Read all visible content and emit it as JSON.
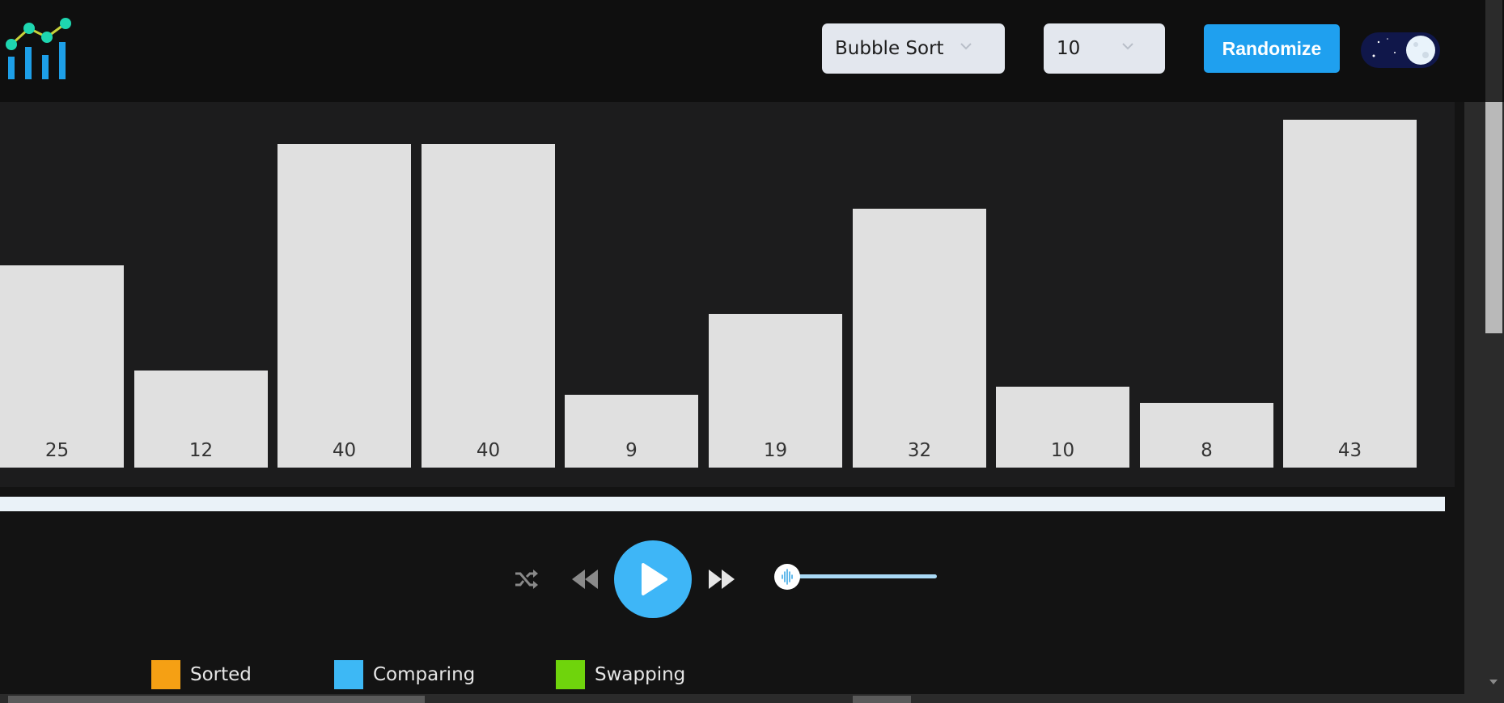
{
  "header": {
    "algorithm_select": {
      "value": "Bubble Sort"
    },
    "count_select": {
      "value": "10"
    },
    "randomize_label": "Randomize",
    "theme_toggle": {
      "mode": "dark",
      "icon": "moon-icon"
    }
  },
  "colors": {
    "accent": "#1fa0ef",
    "play": "#3eb6f7",
    "bar_default": "#e0e0e0",
    "sorted": "#f5a014",
    "comparing": "#3db8f5",
    "swapping": "#6fd40c"
  },
  "chart_data": {
    "type": "bar",
    "categories": [
      "25",
      "12",
      "40",
      "40",
      "9",
      "19",
      "32",
      "10",
      "8",
      "43"
    ],
    "values": [
      25,
      12,
      40,
      40,
      9,
      19,
      32,
      10,
      8,
      43
    ],
    "ylim": [
      0,
      43
    ]
  },
  "progress": 0,
  "speed": 0,
  "controls": {
    "shuffle_icon": "shuffle-icon",
    "rewind_icon": "rewind-icon",
    "play_icon": "play-icon",
    "forward_icon": "fast-forward-icon",
    "speed_icon": "sound-wave-icon"
  },
  "legend": [
    {
      "label": "Sorted",
      "color": "#f5a014"
    },
    {
      "label": "Comparing",
      "color": "#3db8f5"
    },
    {
      "label": "Swapping",
      "color": "#6fd40c"
    }
  ]
}
